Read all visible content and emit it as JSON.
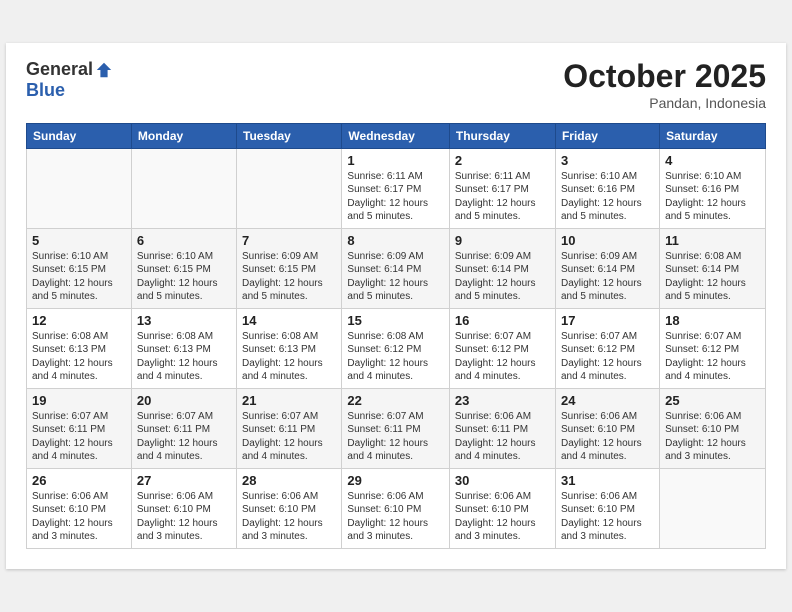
{
  "header": {
    "logo_general": "General",
    "logo_blue": "Blue",
    "month": "October 2025",
    "location": "Pandan, Indonesia"
  },
  "weekdays": [
    "Sunday",
    "Monday",
    "Tuesday",
    "Wednesday",
    "Thursday",
    "Friday",
    "Saturday"
  ],
  "weeks": [
    [
      {
        "day": "",
        "info": ""
      },
      {
        "day": "",
        "info": ""
      },
      {
        "day": "",
        "info": ""
      },
      {
        "day": "1",
        "info": "Sunrise: 6:11 AM\nSunset: 6:17 PM\nDaylight: 12 hours\nand 5 minutes."
      },
      {
        "day": "2",
        "info": "Sunrise: 6:11 AM\nSunset: 6:17 PM\nDaylight: 12 hours\nand 5 minutes."
      },
      {
        "day": "3",
        "info": "Sunrise: 6:10 AM\nSunset: 6:16 PM\nDaylight: 12 hours\nand 5 minutes."
      },
      {
        "day": "4",
        "info": "Sunrise: 6:10 AM\nSunset: 6:16 PM\nDaylight: 12 hours\nand 5 minutes."
      }
    ],
    [
      {
        "day": "5",
        "info": "Sunrise: 6:10 AM\nSunset: 6:15 PM\nDaylight: 12 hours\nand 5 minutes."
      },
      {
        "day": "6",
        "info": "Sunrise: 6:10 AM\nSunset: 6:15 PM\nDaylight: 12 hours\nand 5 minutes."
      },
      {
        "day": "7",
        "info": "Sunrise: 6:09 AM\nSunset: 6:15 PM\nDaylight: 12 hours\nand 5 minutes."
      },
      {
        "day": "8",
        "info": "Sunrise: 6:09 AM\nSunset: 6:14 PM\nDaylight: 12 hours\nand 5 minutes."
      },
      {
        "day": "9",
        "info": "Sunrise: 6:09 AM\nSunset: 6:14 PM\nDaylight: 12 hours\nand 5 minutes."
      },
      {
        "day": "10",
        "info": "Sunrise: 6:09 AM\nSunset: 6:14 PM\nDaylight: 12 hours\nand 5 minutes."
      },
      {
        "day": "11",
        "info": "Sunrise: 6:08 AM\nSunset: 6:14 PM\nDaylight: 12 hours\nand 5 minutes."
      }
    ],
    [
      {
        "day": "12",
        "info": "Sunrise: 6:08 AM\nSunset: 6:13 PM\nDaylight: 12 hours\nand 4 minutes."
      },
      {
        "day": "13",
        "info": "Sunrise: 6:08 AM\nSunset: 6:13 PM\nDaylight: 12 hours\nand 4 minutes."
      },
      {
        "day": "14",
        "info": "Sunrise: 6:08 AM\nSunset: 6:13 PM\nDaylight: 12 hours\nand 4 minutes."
      },
      {
        "day": "15",
        "info": "Sunrise: 6:08 AM\nSunset: 6:12 PM\nDaylight: 12 hours\nand 4 minutes."
      },
      {
        "day": "16",
        "info": "Sunrise: 6:07 AM\nSunset: 6:12 PM\nDaylight: 12 hours\nand 4 minutes."
      },
      {
        "day": "17",
        "info": "Sunrise: 6:07 AM\nSunset: 6:12 PM\nDaylight: 12 hours\nand 4 minutes."
      },
      {
        "day": "18",
        "info": "Sunrise: 6:07 AM\nSunset: 6:12 PM\nDaylight: 12 hours\nand 4 minutes."
      }
    ],
    [
      {
        "day": "19",
        "info": "Sunrise: 6:07 AM\nSunset: 6:11 PM\nDaylight: 12 hours\nand 4 minutes."
      },
      {
        "day": "20",
        "info": "Sunrise: 6:07 AM\nSunset: 6:11 PM\nDaylight: 12 hours\nand 4 minutes."
      },
      {
        "day": "21",
        "info": "Sunrise: 6:07 AM\nSunset: 6:11 PM\nDaylight: 12 hours\nand 4 minutes."
      },
      {
        "day": "22",
        "info": "Sunrise: 6:07 AM\nSunset: 6:11 PM\nDaylight: 12 hours\nand 4 minutes."
      },
      {
        "day": "23",
        "info": "Sunrise: 6:06 AM\nSunset: 6:11 PM\nDaylight: 12 hours\nand 4 minutes."
      },
      {
        "day": "24",
        "info": "Sunrise: 6:06 AM\nSunset: 6:10 PM\nDaylight: 12 hours\nand 4 minutes."
      },
      {
        "day": "25",
        "info": "Sunrise: 6:06 AM\nSunset: 6:10 PM\nDaylight: 12 hours\nand 3 minutes."
      }
    ],
    [
      {
        "day": "26",
        "info": "Sunrise: 6:06 AM\nSunset: 6:10 PM\nDaylight: 12 hours\nand 3 minutes."
      },
      {
        "day": "27",
        "info": "Sunrise: 6:06 AM\nSunset: 6:10 PM\nDaylight: 12 hours\nand 3 minutes."
      },
      {
        "day": "28",
        "info": "Sunrise: 6:06 AM\nSunset: 6:10 PM\nDaylight: 12 hours\nand 3 minutes."
      },
      {
        "day": "29",
        "info": "Sunrise: 6:06 AM\nSunset: 6:10 PM\nDaylight: 12 hours\nand 3 minutes."
      },
      {
        "day": "30",
        "info": "Sunrise: 6:06 AM\nSunset: 6:10 PM\nDaylight: 12 hours\nand 3 minutes."
      },
      {
        "day": "31",
        "info": "Sunrise: 6:06 AM\nSunset: 6:10 PM\nDaylight: 12 hours\nand 3 minutes."
      },
      {
        "day": "",
        "info": ""
      }
    ]
  ]
}
